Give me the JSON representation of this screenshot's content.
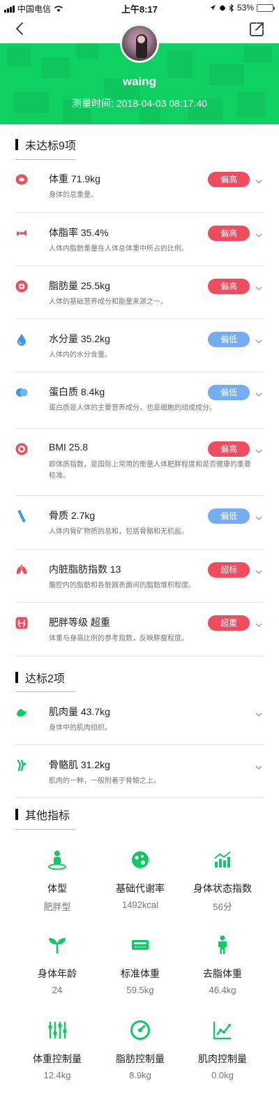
{
  "status_bar": {
    "carrier": "中国电信",
    "time": "上午8:17",
    "battery": "53%",
    "battery_level": 0.53
  },
  "header": {
    "user_name": "waing",
    "measure_time": "测量时间: 2018-04-03 08:17:40",
    "accent_color": "#0fd163"
  },
  "unqualified": {
    "title": "未达标9项",
    "items": [
      {
        "name": "体重 71.9kg",
        "desc": "身体的总重量。",
        "status": "偏高",
        "level": "high",
        "icon": "weight-scale-icon"
      },
      {
        "name": "体脂率 35.4%",
        "desc": "人体内脂肪重量在人体总体重中所占的比例。",
        "status": "偏高",
        "level": "high",
        "icon": "body-fat-icon"
      },
      {
        "name": "脂肪量 25.5kg",
        "desc": "人体的基础营养成分和能量来源之一。",
        "status": "偏高",
        "level": "high",
        "icon": "fat-mass-icon"
      },
      {
        "name": "水分量 35.2kg",
        "desc": "人体内的水分含量。",
        "status": "偏低",
        "level": "low",
        "icon": "water-drop-icon"
      },
      {
        "name": "蛋白质 8.4kg",
        "desc": "蛋白质是人体的主要营养成分，也是细胞的组成成分。",
        "status": "偏低",
        "level": "low",
        "icon": "protein-icon"
      },
      {
        "name": "BMI 25.8",
        "desc": "即体质指数，是国际上常用的衡量人体肥胖程度和是否健康的重要标准。",
        "status": "偏高",
        "level": "high",
        "icon": "bmi-icon"
      },
      {
        "name": "骨质 2.7kg",
        "desc": "人体内骨矿物质的总和，包括骨骼和无机盐。",
        "status": "偏低",
        "level": "low",
        "icon": "bone-icon"
      },
      {
        "name": "内脏脂肪指数 13",
        "desc": "腹腔内的脂肪和各脏器表面间的脂肪堆积程度。",
        "status": "超标",
        "level": "high",
        "icon": "lungs-icon"
      },
      {
        "name": "肥胖等级 超重",
        "desc": "体重与身高比例的参考指数，反映胖瘦程度。",
        "status": "超重",
        "level": "high",
        "icon": "obesity-level-icon"
      }
    ]
  },
  "qualified": {
    "title": "达标2项",
    "items": [
      {
        "name": "肌肉量 43.7kg",
        "desc": "身体中的肌肉组织。",
        "icon": "muscle-icon"
      },
      {
        "name": "骨骼肌 31.2kg",
        "desc": "肌肉的一种，一般附着于骨骼之上。",
        "icon": "skeletal-muscle-icon"
      }
    ]
  },
  "others": {
    "title": "其他指标",
    "items": [
      {
        "label": "体型",
        "value": "肥胖型",
        "icon": "body-type-icon"
      },
      {
        "label": "基础代谢率",
        "value": "1492kcal",
        "icon": "metabolism-icon"
      },
      {
        "label": "身体状态指数",
        "value": "56分",
        "icon": "status-chart-icon"
      },
      {
        "label": "身体年龄",
        "value": "24",
        "icon": "sprout-icon"
      },
      {
        "label": "标准体重",
        "value": "59.5kg",
        "icon": "standard-weight-icon"
      },
      {
        "label": "去脂体重",
        "value": "46.4kg",
        "icon": "person-icon"
      },
      {
        "label": "体重控制量",
        "value": "12.4kg",
        "icon": "sliders-icon"
      },
      {
        "label": "脂肪控制量",
        "value": "8.9kg",
        "icon": "gauge-icon"
      },
      {
        "label": "肌肉控制量",
        "value": "0.0kg",
        "icon": "line-chart-icon"
      }
    ]
  }
}
